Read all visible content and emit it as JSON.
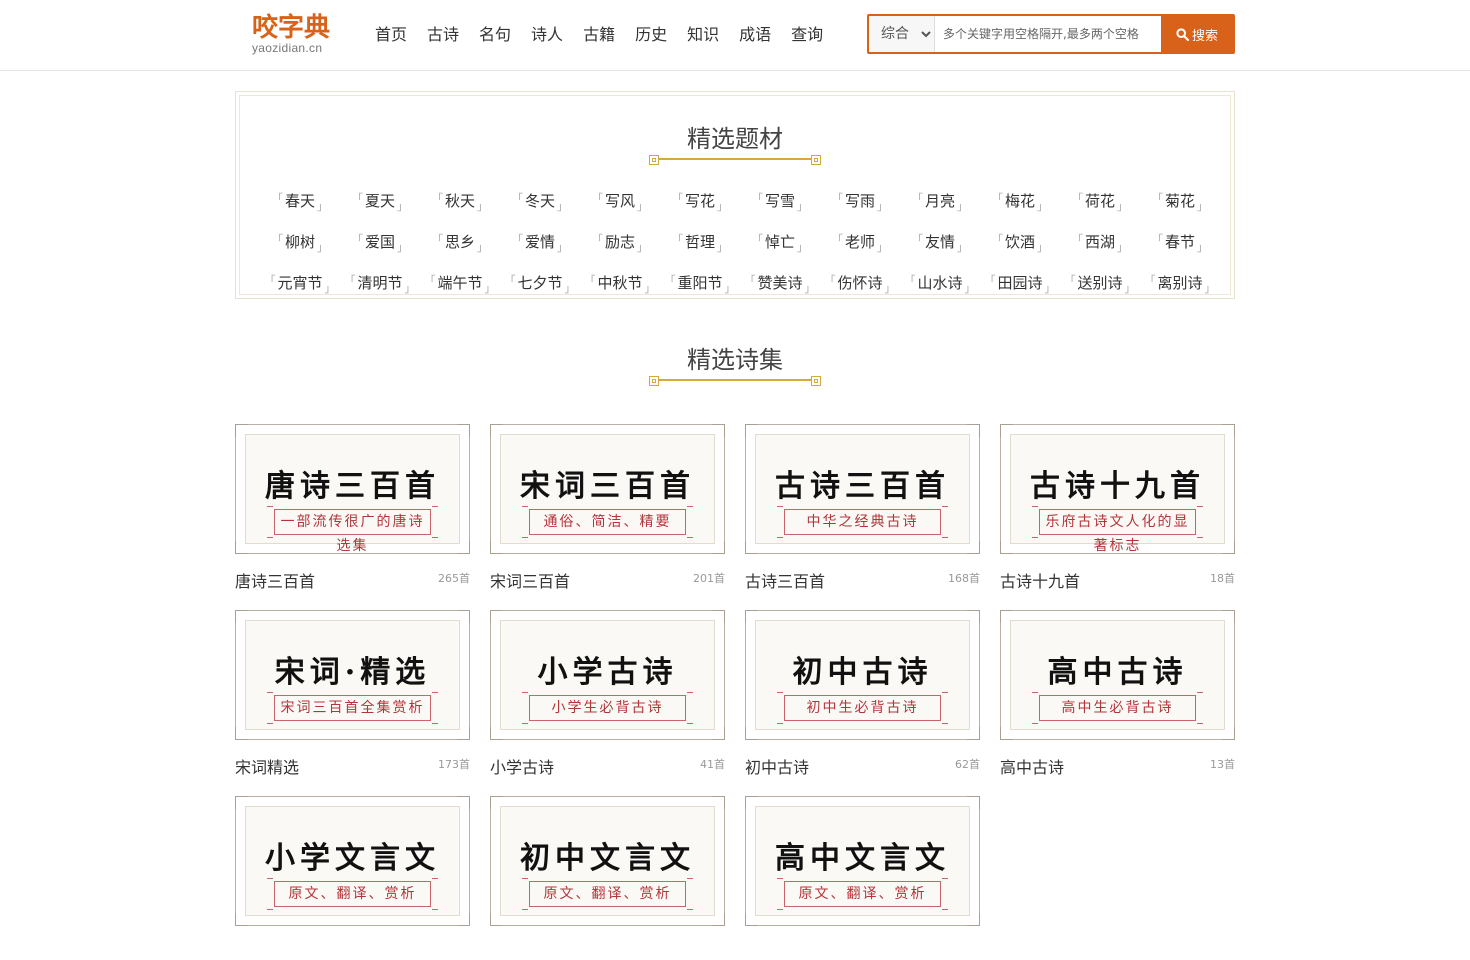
{
  "logo": {
    "cn": "咬字典",
    "en": "yaozidian.cn"
  },
  "nav": [
    "首页",
    "古诗",
    "名句",
    "诗人",
    "古籍",
    "历史",
    "知识",
    "成语",
    "查询"
  ],
  "search": {
    "select_value": "综合",
    "placeholder": "多个关键字用空格隔开,最多两个空格",
    "button_label": "搜索"
  },
  "topics": {
    "title": "精选题材",
    "items": [
      "春天",
      "夏天",
      "秋天",
      "冬天",
      "写风",
      "写花",
      "写雪",
      "写雨",
      "月亮",
      "梅花",
      "荷花",
      "菊花",
      "柳树",
      "爱国",
      "思乡",
      "爱情",
      "励志",
      "哲理",
      "悼亡",
      "老师",
      "友情",
      "饮酒",
      "西湖",
      "春节",
      "元宵节",
      "清明节",
      "端午节",
      "七夕节",
      "中秋节",
      "重阳节",
      "赞美诗",
      "伤怀诗",
      "山水诗",
      "田园诗",
      "送别诗",
      "离别诗"
    ]
  },
  "collections": {
    "title": "精选诗集",
    "items": [
      {
        "cover_title": "唐诗三百首",
        "cover_sub": "一部流传很广的唐诗选集",
        "name": "唐诗三百首",
        "count": "265首"
      },
      {
        "cover_title": "宋词三百首",
        "cover_sub": "通俗、简洁、精要",
        "name": "宋词三百首",
        "count": "201首"
      },
      {
        "cover_title": "古诗三百首",
        "cover_sub": "中华之经典古诗",
        "name": "古诗三百首",
        "count": "168首"
      },
      {
        "cover_title": "古诗十九首",
        "cover_sub": "乐府古诗文人化的显著标志",
        "name": "古诗十九首",
        "count": "18首"
      },
      {
        "cover_title": "宋词·精选",
        "cover_sub": "宋词三百首全集赏析",
        "name": "宋词精选",
        "count": "173首"
      },
      {
        "cover_title": "小学古诗",
        "cover_sub": "小学生必背古诗",
        "name": "小学古诗",
        "count": "41首"
      },
      {
        "cover_title": "初中古诗",
        "cover_sub": "初中生必背古诗",
        "name": "初中古诗",
        "count": "62首"
      },
      {
        "cover_title": "高中古诗",
        "cover_sub": "高中生必背古诗",
        "name": "高中古诗",
        "count": "13首"
      },
      {
        "cover_title": "小学文言文",
        "cover_sub": "原文、翻译、赏析",
        "name": "",
        "count": ""
      },
      {
        "cover_title": "初中文言文",
        "cover_sub": "原文、翻译、赏析",
        "name": "",
        "count": ""
      },
      {
        "cover_title": "高中文言文",
        "cover_sub": "原文、翻译、赏析",
        "name": "",
        "count": ""
      }
    ]
  },
  "colors": {
    "accent": "#d9621a",
    "gold": "#d4aa3c",
    "seal_red": "#b4343a"
  }
}
